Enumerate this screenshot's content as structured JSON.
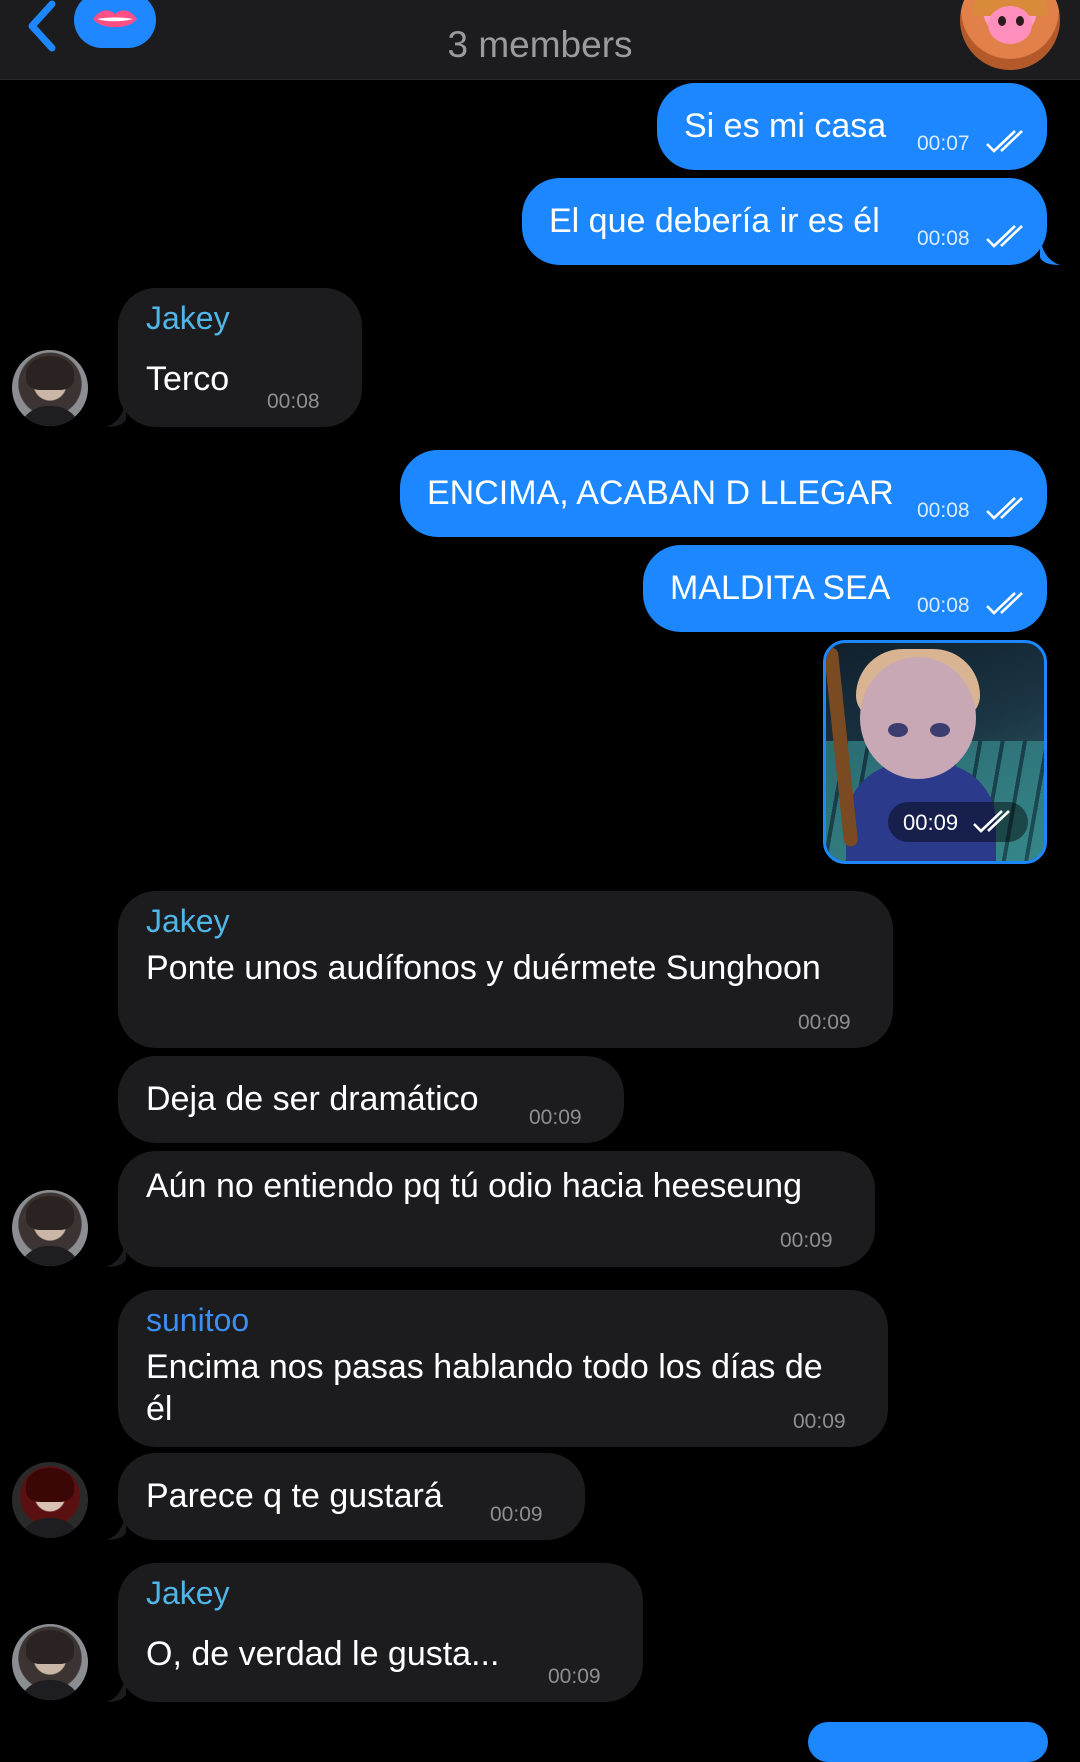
{
  "header": {
    "subtitle": "3 members",
    "group_emoji": "lips-emoji"
  },
  "messages": [
    {
      "id": "m1",
      "dir": "out",
      "text": "Si es mi casa",
      "time": "00:07",
      "status": "read"
    },
    {
      "id": "m2",
      "dir": "out",
      "text": "El que debería ir es él",
      "time": "00:08",
      "status": "read"
    },
    {
      "id": "m3",
      "dir": "in",
      "sender": "Jakey",
      "text": "Terco",
      "time": "00:08"
    },
    {
      "id": "m4",
      "dir": "out",
      "text": "ENCIMA, ACABAN D LLEGAR",
      "time": "00:08",
      "status": "read"
    },
    {
      "id": "m5",
      "dir": "out",
      "text": "MALDITA SEA",
      "time": "00:08",
      "status": "read"
    },
    {
      "id": "m6",
      "dir": "out",
      "type": "photo",
      "time": "00:09",
      "status": "read"
    },
    {
      "id": "m7",
      "dir": "in",
      "sender": "Jakey",
      "text": "Ponte unos audífonos y duérmete Sunghoon",
      "time": "00:09"
    },
    {
      "id": "m8",
      "dir": "in",
      "text": "Deja de ser dramático",
      "time": "00:09"
    },
    {
      "id": "m9",
      "dir": "in",
      "text": "Aún no entiendo pq tú odio hacia heeseung",
      "time": "00:09"
    },
    {
      "id": "m10",
      "dir": "in",
      "sender": "sunitoo",
      "text_line1": "Encima nos pasas hablando todo los días de",
      "text_line2": "él",
      "time": "00:09"
    },
    {
      "id": "m11",
      "dir": "in",
      "text": "Parece q te gustará",
      "time": "00:09"
    },
    {
      "id": "m12",
      "dir": "in",
      "sender": "Jakey",
      "text": "O, de verdad le gusta...",
      "time": "00:09"
    }
  ],
  "colors": {
    "outgoing_bubble": "#1c87ff",
    "incoming_bubble": "#1c1c1e",
    "sender_jakey": "#4fb6e8",
    "sender_sunitoo": "#3b8ff0"
  }
}
